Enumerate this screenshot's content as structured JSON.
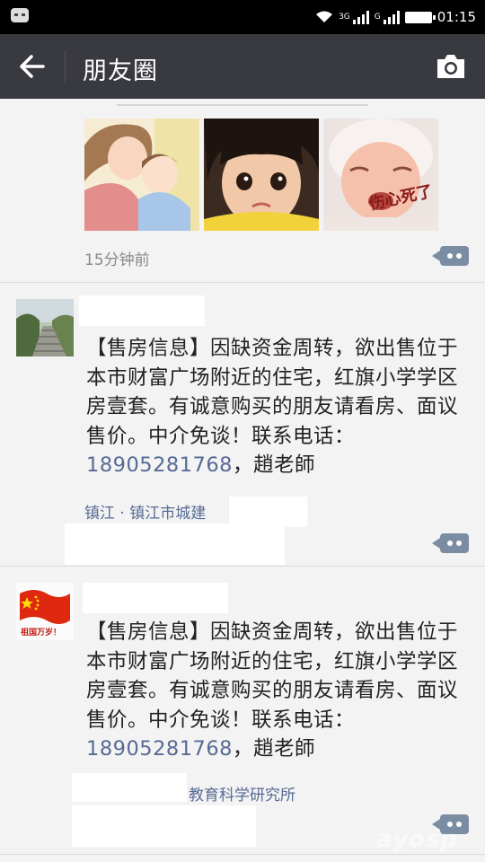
{
  "titlebar": {
    "title": "朋友圈"
  },
  "statusbar": {
    "time": "01:15",
    "net1": "3G",
    "net2": "G"
  },
  "post1": {
    "time": "15分钟前",
    "sticker_text": "伤心死了"
  },
  "post2": {
    "text": "【售房信息】因缺资金周转，欲出售位于本市财富广场附近的住宅，红旗小学学区房壹套。有诚意购买的朋友请看房、面议售价。中介免谈！联系电话：",
    "phone": "18905281768",
    "sign": "，趙老師",
    "location": "镇江 · 镇江市城建"
  },
  "post3": {
    "avatar_text": "祖国万岁！",
    "text": "【售房信息】因缺资金周转，欲出售位于本市财富广场附近的住宅，红旗小学学区房壹套。有诚意购买的朋友请看房、面议售价。中介免谈！联系电话：",
    "phone": "18905281768",
    "sign": "，趙老師",
    "location": "教育科学研究所"
  },
  "watermark": "ayosp"
}
